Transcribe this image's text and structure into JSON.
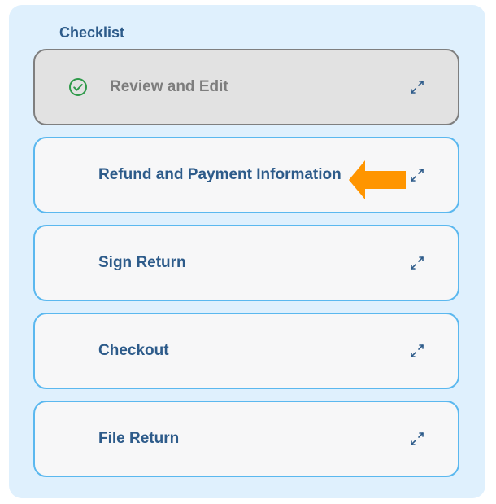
{
  "checklist": {
    "title": "Checklist",
    "items": [
      {
        "label": "Review and Edit",
        "status": "completed",
        "icon": "check-circle-icon",
        "action_icon": "expand-icon"
      },
      {
        "label": "Refund and Payment Information",
        "status": "current",
        "action_icon": "expand-icon",
        "indicator": "arrow-left-icon"
      },
      {
        "label": "Sign Return",
        "status": "pending",
        "action_icon": "expand-icon"
      },
      {
        "label": "Checkout",
        "status": "pending",
        "action_icon": "expand-icon"
      },
      {
        "label": "File Return",
        "status": "pending",
        "action_icon": "expand-icon"
      }
    ]
  },
  "colors": {
    "panel_background": "#dff0fd",
    "item_border": "#5bb8ef",
    "completed_border": "#7f7f7f",
    "completed_background": "#e2e2e2",
    "label_text": "#2d5b8a",
    "completed_text": "#7d7d7d",
    "check_green": "#2f9a4a",
    "arrow_orange": "#ff9500"
  }
}
